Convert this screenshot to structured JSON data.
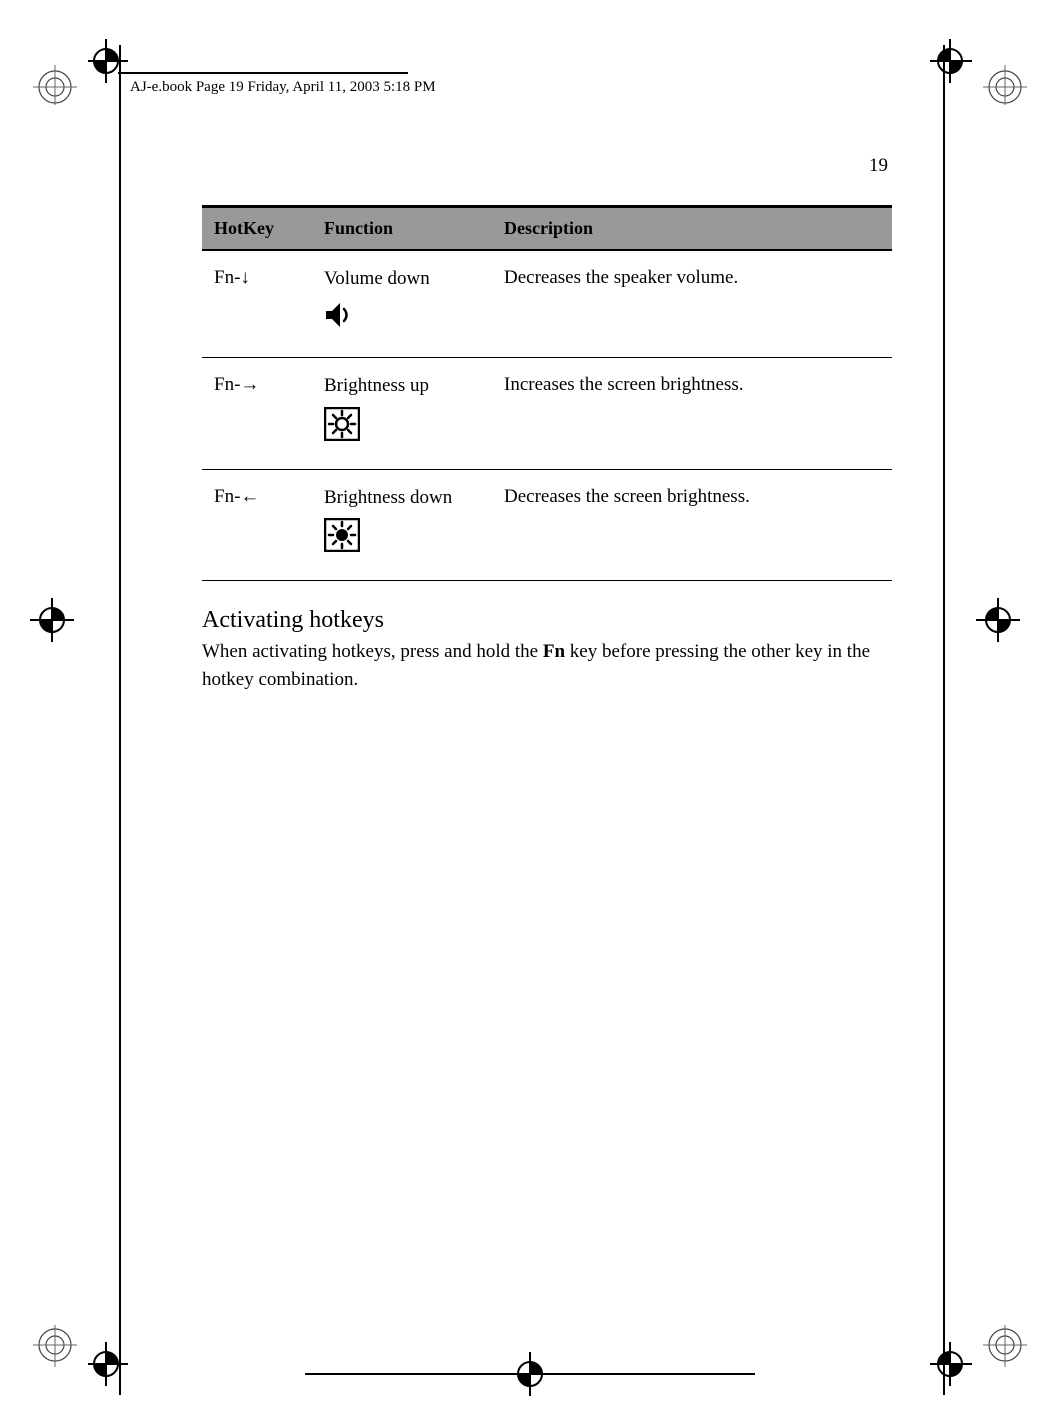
{
  "header": {
    "file_info": "AJ-e.book  Page 19  Friday, April 11, 2003  5:18 PM"
  },
  "page_number": "19",
  "table": {
    "headers": {
      "hotkey": "HotKey",
      "function": "Function",
      "description": "Description"
    },
    "rows": [
      {
        "hotkey": "Fn-↓",
        "function": "Volume down",
        "description": "Decreases the speaker volume."
      },
      {
        "hotkey": "Fn-→",
        "function": "Brightness up",
        "description": "Increases the screen brightness."
      },
      {
        "hotkey": "Fn-←",
        "function": "Brightness down",
        "description": "Decreases the screen brightness."
      }
    ]
  },
  "section": {
    "heading": "Activating hotkeys",
    "body_pre": "When activating hotkeys, press and hold the ",
    "body_bold": "Fn",
    "body_post": " key before pressing the other key in the hotkey combination."
  }
}
